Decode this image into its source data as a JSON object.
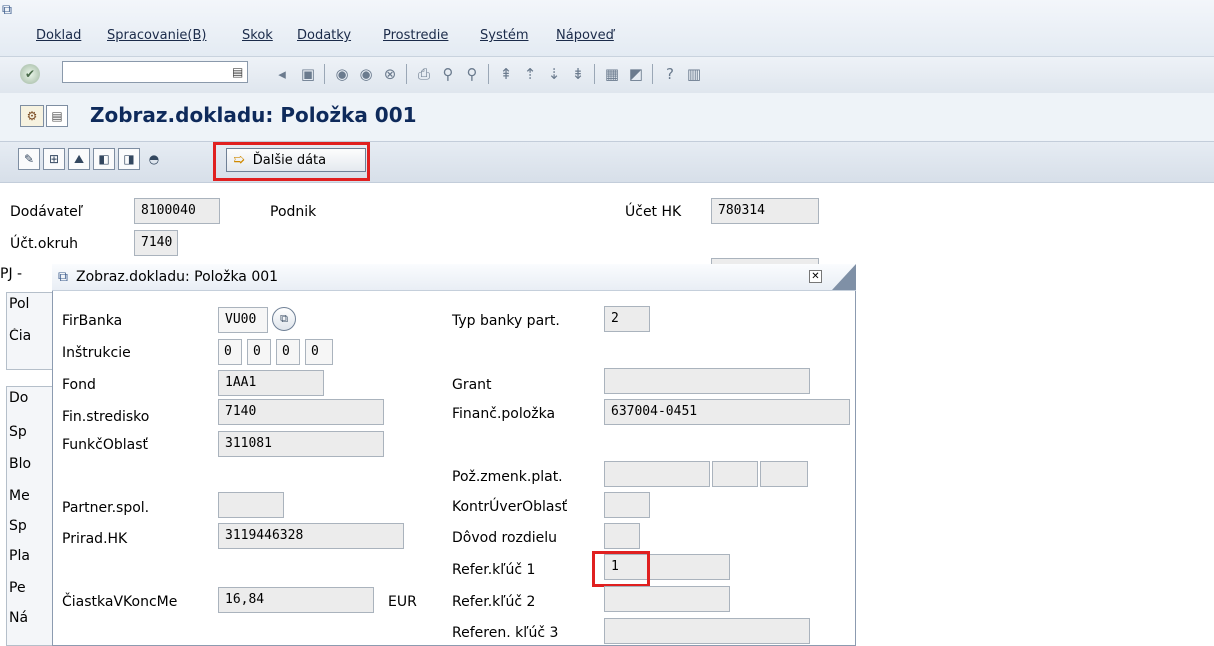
{
  "top_banner": "",
  "menu": {
    "items": [
      "Doklad",
      "Spracovanie(B)",
      "Skok",
      "Dodatky",
      "Prostredie",
      "Systém",
      "Nápoveď"
    ]
  },
  "toolbar": {
    "command_value": ""
  },
  "header": {
    "title": "Zobraz.dokladu: Položka 001"
  },
  "app_toolbar": {
    "more_data_label": "Ďalšie dáta"
  },
  "main": {
    "vendor_label": "Dodávateľ",
    "vendor_value": "8100040",
    "company_label": "Podnik",
    "gl_account_label": "Účet HK",
    "gl_account_value": "780314",
    "control_area_label": "Účt.okruh",
    "control_area_value": "7140",
    "side_fragments": [
      "PJ -",
      "Pol",
      "Čia",
      "Do",
      "Sp",
      "Blo",
      "Me",
      "Sp",
      "Pla",
      "Pe",
      "Ná"
    ]
  },
  "popup": {
    "title": "Zobraz.dokladu: Položka 001",
    "left": {
      "fir_bank_label": "FirBanka",
      "fir_bank_value": "VU00",
      "instructions_label": "Inštrukcie",
      "instructions_values": [
        "0",
        "0",
        "0",
        "0"
      ],
      "fund_label": "Fond",
      "fund_value": "1AA1",
      "fin_center_label": "Fin.stredisko",
      "fin_center_value": "7140",
      "func_area_label": "FunkčOblasť",
      "func_area_value": "311081",
      "partner_label": "Partner.spol.",
      "partner_value": "",
      "assign_gl_label": "Prirad.HK",
      "assign_gl_value": "3119446328",
      "amount_label": "ČiastkaVKoncMe",
      "amount_value": "16,84",
      "currency": "EUR"
    },
    "right": {
      "partner_bank_type_label": "Typ banky part.",
      "partner_bank_type_value": "2",
      "grant_label": "Grant",
      "grant_value": "",
      "commitment_item_label": "Finanč.položka",
      "commitment_item_value": "637004-0451",
      "payment_change_label": "Pož.zmenk.plat.",
      "control_area_label": "KontrÚverOblasť",
      "reason_diff_label": "Dôvod rozdielu",
      "ref_key1_label": "Refer.kľúč 1",
      "ref_key1_value": "1",
      "ref_key2_label": "Refer.kľúč 2",
      "ref_key2_value": "",
      "ref_key3_label": "Referen. kľúč 3",
      "ref_key3_value": ""
    }
  },
  "colors": {
    "highlight": "#e02020",
    "title": "#0e2a5b"
  }
}
